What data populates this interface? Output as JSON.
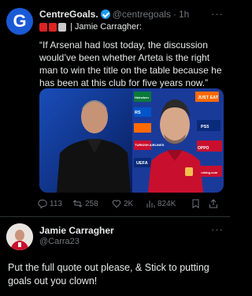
{
  "tweet": {
    "author_name": "CentreGoals.",
    "author_handle": "@centregoals",
    "separator": "·",
    "time": "1h",
    "avatar_letter": "G",
    "subline_text": "| Jamie Carragher:",
    "body": "“If Arsenal had lost today, the discussion would’ve been whether Arteta is the right man to win the title on the table because he has been at this club for five years now.”",
    "more": "···",
    "actions": {
      "replies": "113",
      "retweets": "258",
      "likes": "2K",
      "views": "824K"
    }
  },
  "reply": {
    "author_name": "Jamie Carragher",
    "author_handle": "@Carra23",
    "more": "···",
    "body": "Put the full quote out please, & Stick to putting goals out you clown!"
  },
  "media": {
    "board_labels": [
      "JUST EAT",
      "PS5",
      "TURKISH AIRLINES",
      "UEFA",
      "Heineken",
      "Booking.com",
      "OPPO",
      "RS"
    ]
  },
  "colors": {
    "accent": "#1d9bf0",
    "background": "#000000",
    "muted": "#71767b"
  }
}
